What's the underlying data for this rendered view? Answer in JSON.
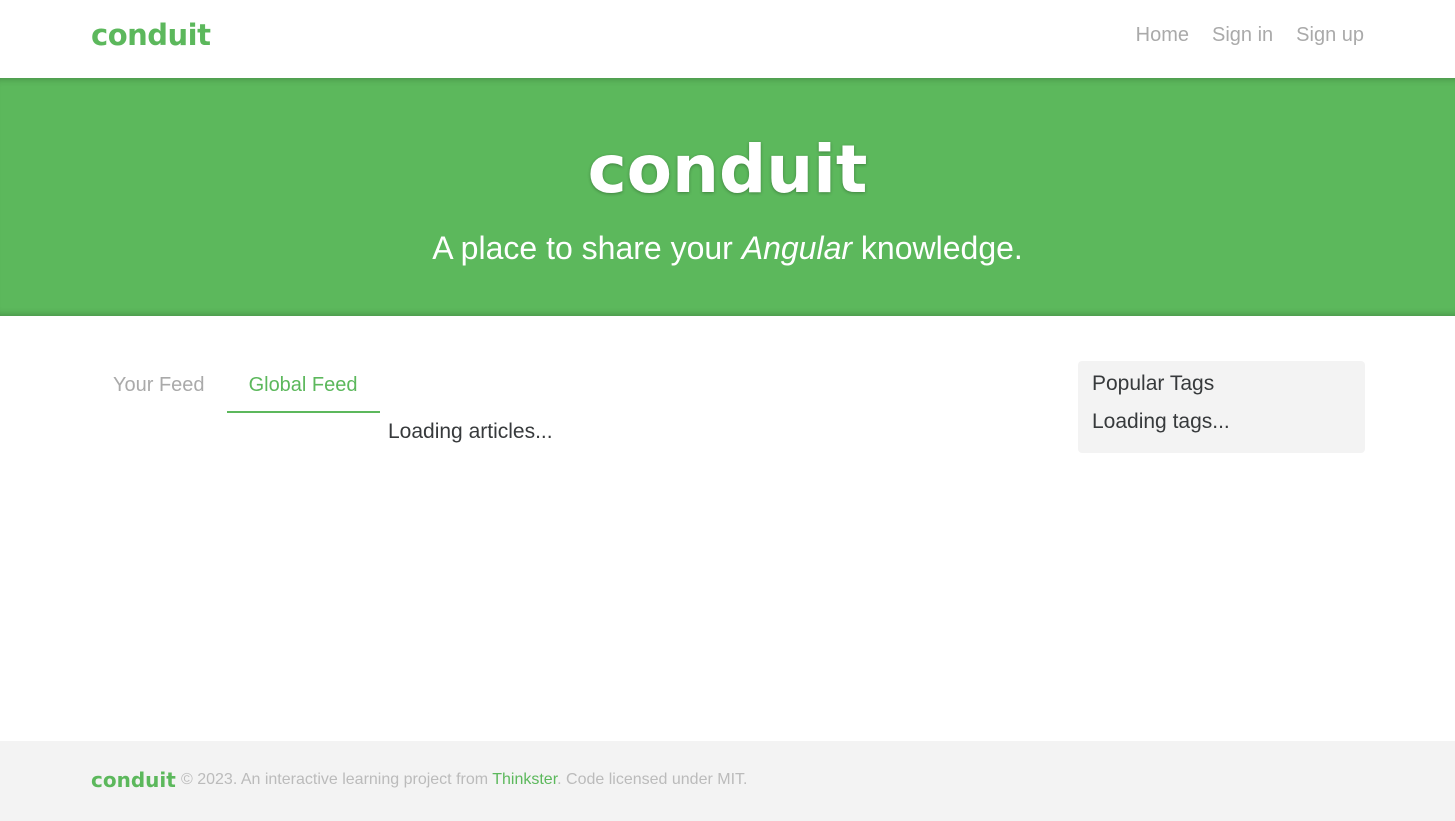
{
  "navbar": {
    "brand": "conduit",
    "links": [
      {
        "label": "Home"
      },
      {
        "label": "Sign in"
      },
      {
        "label": "Sign up"
      }
    ]
  },
  "banner": {
    "title": "conduit",
    "subtitle_before": "A place to share your ",
    "subtitle_emphasis": "Angular",
    "subtitle_after": " knowledge."
  },
  "feed": {
    "tabs": [
      {
        "label": "Your Feed",
        "active": false
      },
      {
        "label": "Global Feed",
        "active": true
      }
    ],
    "loading_text": "Loading articles..."
  },
  "sidebar": {
    "title": "Popular Tags",
    "loading_text": "Loading tags..."
  },
  "footer": {
    "brand": "conduit",
    "text_before": "© 2023. An interactive learning project from ",
    "link_label": "Thinkster",
    "text_after": ". Code licensed under MIT."
  },
  "colors": {
    "brand": "#5cb85c",
    "muted": "#aaaaaa",
    "text": "#373a3c",
    "panel": "#f3f3f3"
  }
}
